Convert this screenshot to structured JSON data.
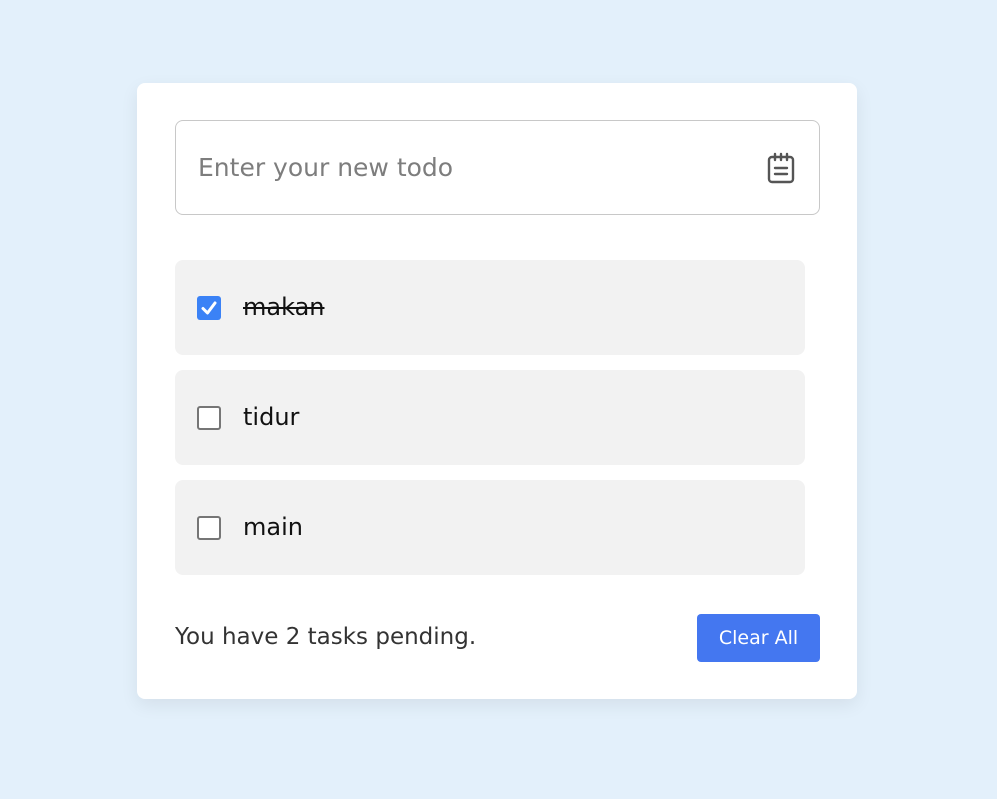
{
  "input": {
    "placeholder": "Enter your new todo",
    "value": "",
    "icon": "notepad-icon"
  },
  "todos": [
    {
      "text": "makan",
      "done": true
    },
    {
      "text": "tidur",
      "done": false
    },
    {
      "text": "main",
      "done": false
    }
  ],
  "footer": {
    "pending_text": "You have 2 tasks pending.",
    "clear_label": "Clear All"
  },
  "colors": {
    "background": "#e3f0fb",
    "accent": "#4477f0",
    "checkbox_checked": "#3b82f6",
    "item_background": "#f2f2f2"
  }
}
